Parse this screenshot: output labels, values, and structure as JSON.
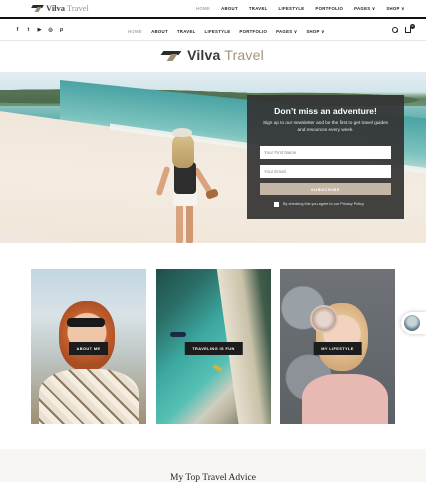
{
  "site": {
    "logo_bold": "Vilva",
    "logo_light": " Travel"
  },
  "top_nav": [
    "HOME",
    "ABOUT",
    "TRAVEL",
    "LIFESTYLE",
    "PORTFOLIO",
    "PAGES ∨",
    "SHOP ∨"
  ],
  "main_nav": [
    "HOME",
    "ABOUT",
    "TRAVEL",
    "LIFESTYLE",
    "PORTFOLIO",
    "PAGES ∨",
    "SHOP ∨"
  ],
  "social_icons": [
    "facebook-icon",
    "twitter-icon",
    "youtube-icon",
    "instagram-icon",
    "pinterest-icon"
  ],
  "social_glyphs": [
    "f",
    "t",
    "▶",
    "◎",
    "p"
  ],
  "cart": {
    "count": "0"
  },
  "subscribe": {
    "title": "Don’t miss an adventure!",
    "text": "Sign up to our newsletter and be the first to get travel guides and resources every week.",
    "first_name_placeholder": "Your First Name",
    "email_placeholder": "Your Email",
    "button": "SUBSCRIBE",
    "consent": "By checking this you agree to our Privacy Policy."
  },
  "cards": [
    {
      "label": "ABOUT ME"
    },
    {
      "label": "TRAVELING IS FUN"
    },
    {
      "label": "MY LIFESTYLE"
    }
  ],
  "section_title": "My Top Travel Advice",
  "colors": {
    "accent": "#c4b6a5",
    "logo_tan": "#a39478",
    "dark": "#1c1c1c"
  }
}
